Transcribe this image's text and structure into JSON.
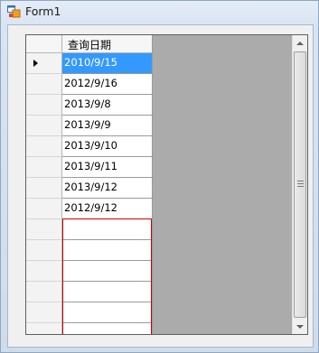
{
  "window": {
    "title": "Form1"
  },
  "grid": {
    "column_header": "查询日期",
    "rows": [
      "2010/9/15",
      "2012/9/16",
      "2013/9/8",
      "2013/9/9",
      "2013/9/10",
      "2013/9/11",
      "2013/9/12",
      "2012/9/12",
      "",
      "",
      "",
      "",
      "",
      ""
    ],
    "selected_row": 0
  },
  "colors": {
    "selection": "#3399ff",
    "empty_rows_outline": "#cc0000",
    "grid_background": "#ababab"
  }
}
